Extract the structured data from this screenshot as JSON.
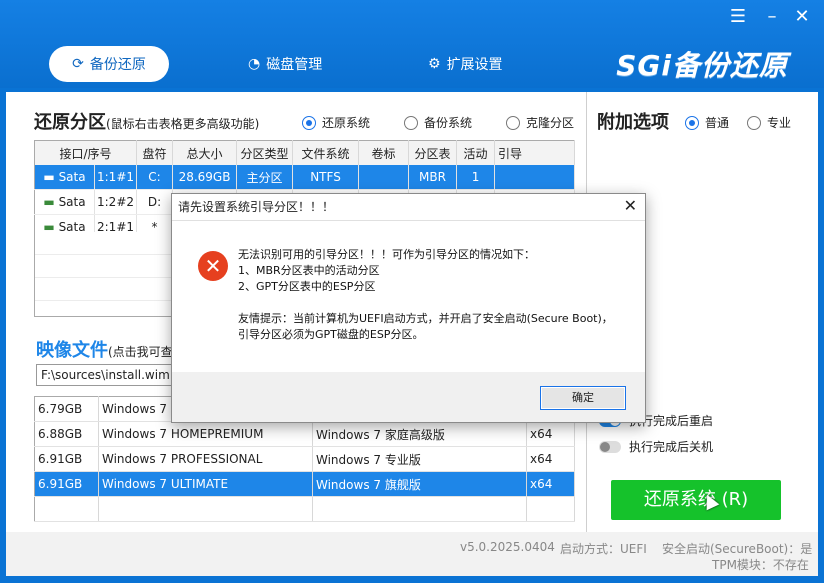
{
  "window": {
    "brand": "SGi备份还原",
    "tabs": [
      {
        "label": "备份还原",
        "active": true,
        "icon": "refresh-icon"
      },
      {
        "label": "磁盘管理",
        "active": false,
        "icon": "pie-chart-icon"
      },
      {
        "label": "扩展设置",
        "active": false,
        "icon": "gear-icon"
      }
    ],
    "controls": {
      "menu": "☰",
      "minimize": "–",
      "close": "✕"
    }
  },
  "restore_partition": {
    "title": "还原分区",
    "hint": "(鼠标右击表格更多高级功能)",
    "modes": [
      {
        "label": "还原系统",
        "selected": true
      },
      {
        "label": "备份系统",
        "selected": false
      },
      {
        "label": "克隆分区",
        "selected": false
      }
    ],
    "columns": [
      "接口/序号",
      "",
      "盘符",
      "总大小",
      "分区类型",
      "文件系统",
      "卷标",
      "分区表",
      "活动",
      "引导"
    ],
    "rows": [
      {
        "iface": "Sata",
        "index": "1:1#1",
        "drive": "C:",
        "size": "28.69GB",
        "type": "主分区",
        "fs": "NTFS",
        "label": "",
        "table": "MBR",
        "active": "1",
        "boot": "",
        "selected": true
      },
      {
        "iface": "Sata",
        "index": "1:2#2",
        "drive": "D:",
        "size": "",
        "type": "",
        "fs": "",
        "label": "",
        "table": "",
        "active": "",
        "boot": "",
        "selected": false
      },
      {
        "iface": "Sata",
        "index": "2:1#1",
        "drive": "*",
        "size": "",
        "type": "",
        "fs": "",
        "label": "",
        "table": "",
        "active": "",
        "boot": "",
        "selected": false
      }
    ]
  },
  "image_file": {
    "title": "映像文件",
    "hint": "(点击我可查",
    "path": "F:\\sources\\install.wim",
    "rows": [
      {
        "size": "6.79GB",
        "name": "Windows 7 I",
        "desc": "",
        "arch": "",
        "selected": false
      },
      {
        "size": "6.88GB",
        "name": "Windows 7 HOMEPREMIUM",
        "desc": "Windows 7 家庭高级版",
        "arch": "x64",
        "selected": false
      },
      {
        "size": "6.91GB",
        "name": "Windows 7 PROFESSIONAL",
        "desc": "Windows 7 专业版",
        "arch": "x64",
        "selected": false
      },
      {
        "size": "6.91GB",
        "name": "Windows 7 ULTIMATE",
        "desc": "Windows 7 旗舰版",
        "arch": "x64",
        "selected": true
      }
    ]
  },
  "extra_options": {
    "title": "附加选项",
    "modes": [
      {
        "label": "普通",
        "selected": true
      },
      {
        "label": "专业",
        "selected": false
      }
    ],
    "toggles": [
      {
        "label": "执行完成后重启",
        "on": true
      },
      {
        "label": "执行完成后关机",
        "on": false
      }
    ],
    "action_button": "还原系统 (R)"
  },
  "status_bar": {
    "version": "v5.0.2025.0404",
    "boot_mode": "启动方式：UEFI",
    "secure_boot": "安全启动(SecureBoot)：是",
    "tpm": "TPM模块：不存在"
  },
  "dialog": {
    "title": "请先设置系统引导分区！！！",
    "close": "✕",
    "lines": [
      "无法识别可用的引导分区！！！可作为引导分区的情况如下：",
      "1、MBR分区表中的活动分区",
      "2、GPT分区表中的ESP分区",
      "",
      "友情提示：当前计算机为UEFI启动方式，并开启了安全启动(Secure Boot)，",
      "引导分区必须为GPT磁盘的ESP分区。"
    ],
    "ok_label": "确定"
  },
  "colors": {
    "accent": "#1e86e8",
    "title_bar": "#0a73d4",
    "action": "#15c22b",
    "error": "#e6401f"
  }
}
